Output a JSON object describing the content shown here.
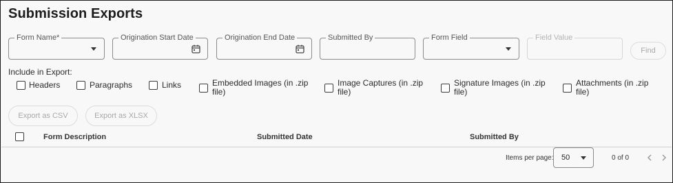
{
  "page": {
    "title": "Submission Exports"
  },
  "filters": {
    "form_name": {
      "label": "Form Name*",
      "value": ""
    },
    "origination_start": {
      "label": "Origination Start Date",
      "value": ""
    },
    "origination_end": {
      "label": "Origination End Date",
      "value": ""
    },
    "submitted_by": {
      "label": "Submitted By",
      "value": ""
    },
    "form_field": {
      "label": "Form Field",
      "value": ""
    },
    "field_value": {
      "label": "Field Value",
      "value": ""
    },
    "find_label": "Find"
  },
  "include": {
    "label": "Include in Export:",
    "options": [
      {
        "label": "Headers",
        "checked": false
      },
      {
        "label": "Paragraphs",
        "checked": false
      },
      {
        "label": "Links",
        "checked": false
      },
      {
        "label": "Embedded Images (in .zip file)",
        "line1": "Embedded Images (in .zip",
        "line2": "file)",
        "checked": false
      },
      {
        "label": "Image Captures (in .zip file)",
        "line1": "Image Captures (in .zip",
        "line2": "file)",
        "checked": false
      },
      {
        "label": "Signature Images (in .zip file)",
        "line1": "Signature Images (in .zip",
        "line2": "file)",
        "checked": false
      },
      {
        "label": "Attachments (in .zip file)",
        "line1": "Attachments (in .zip",
        "line2": "file)",
        "checked": false
      }
    ]
  },
  "actions": {
    "export_csv": "Export as CSV",
    "export_xlsx": "Export as XLSX"
  },
  "table": {
    "columns": [
      "Form Description",
      "Submitted Date",
      "Submitted By"
    ],
    "rows": []
  },
  "pagination": {
    "items_per_page_label": "Items per page:",
    "items_per_page": "50",
    "range": "0 of 0"
  },
  "colors": {
    "border": "#8a8a8a",
    "disabled": "#a8a8a8",
    "background": "#f8f8f8"
  }
}
